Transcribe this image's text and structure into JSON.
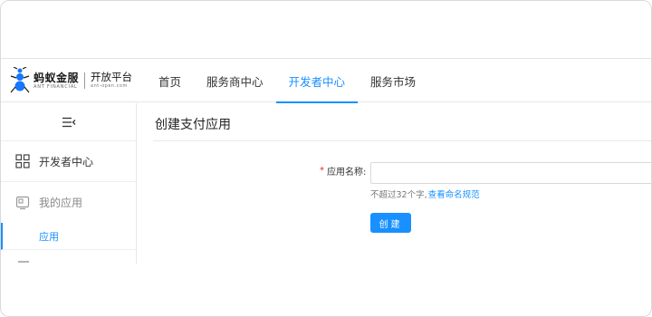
{
  "brand": {
    "name": "蚂蚁金服",
    "name_en": "ANT FINANCIAL",
    "platform": "开放平台",
    "domain": "ant-open.com"
  },
  "nav": {
    "items": [
      {
        "label": "首页",
        "active": false
      },
      {
        "label": "服务商中心",
        "active": false
      },
      {
        "label": "开发者中心",
        "active": true
      },
      {
        "label": "服务市场",
        "active": false
      }
    ]
  },
  "sidebar": {
    "toggle_icon": "menu-collapse-icon",
    "items": [
      {
        "label": "开发者中心",
        "icon": "grid-icon"
      },
      {
        "label": "我的应用",
        "icon": "app-icon"
      }
    ],
    "sub_item": {
      "label": "应用",
      "active": true
    }
  },
  "main": {
    "title": "创建支付应用",
    "form": {
      "required_mark": "*",
      "field_label": "应用名称:",
      "field_value": "",
      "hint_text": "不超过32个字,",
      "hint_link": "查看命名规范",
      "submit_label": "创建"
    }
  },
  "colors": {
    "accent": "#1890ff",
    "required": "#f5222d",
    "border": "#e8e8e8"
  }
}
